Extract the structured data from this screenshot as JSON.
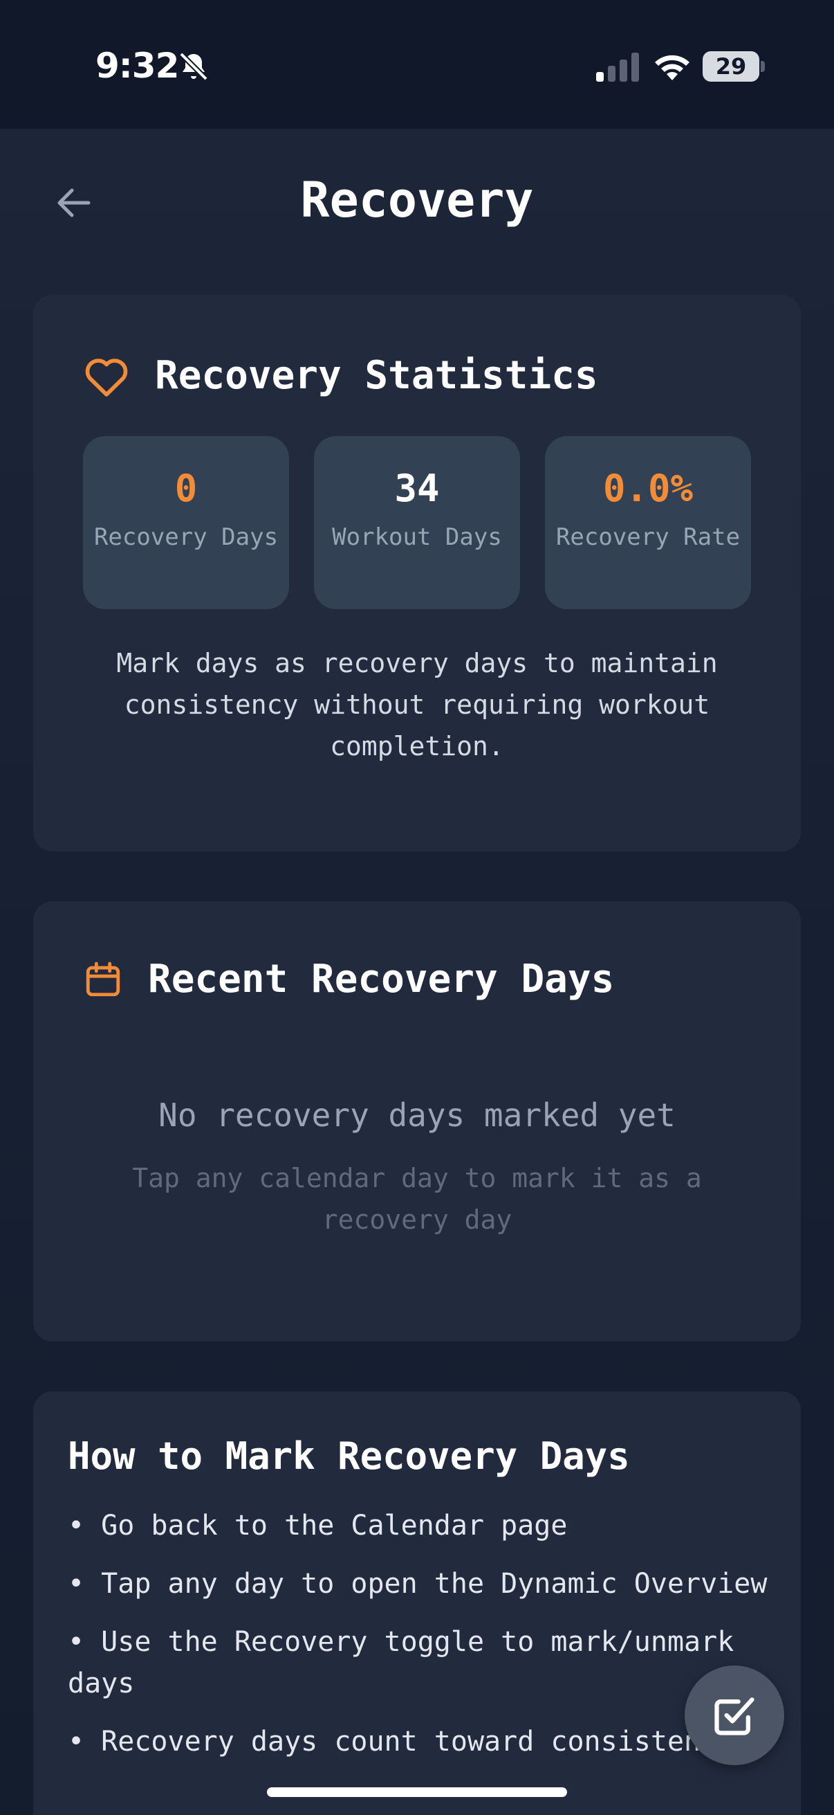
{
  "status_bar": {
    "time": "9:32",
    "battery": "29",
    "icons": [
      "bell-slash-icon",
      "cellular-signal-icon",
      "wifi-icon",
      "battery-icon"
    ]
  },
  "header": {
    "back_icon": "arrow-left-icon",
    "title": "Recovery"
  },
  "stats_card": {
    "icon": "heart-icon",
    "title": "Recovery Statistics",
    "stats": [
      {
        "value": "0",
        "label": "Recovery Days"
      },
      {
        "value": "34",
        "label": "Workout Days"
      },
      {
        "value": "0.0%",
        "label": "Recovery Rate"
      }
    ],
    "description": "Mark days as recovery days to maintain consistency without requiring workout completion."
  },
  "recent_card": {
    "icon": "calendar-icon",
    "title": "Recent Recovery Days",
    "empty_title": "No recovery days marked yet",
    "empty_subtitle": "Tap any calendar day to mark it as a recovery day"
  },
  "how_to_card": {
    "title": "How to Mark Recovery Days",
    "items": [
      "• Go back to the Calendar page",
      "• Tap any day to open the Dynamic Overview",
      "• Use the Recovery toggle to mark/unmark days",
      "• Recovery days count toward consistency"
    ]
  },
  "fab": {
    "icon": "checkbox-edit-icon"
  },
  "colors": {
    "accent": "#f28c38",
    "background": "#121a2b",
    "card": "#212b3d",
    "stat_box": "#334155",
    "muted_text": "#9aa5b4"
  }
}
